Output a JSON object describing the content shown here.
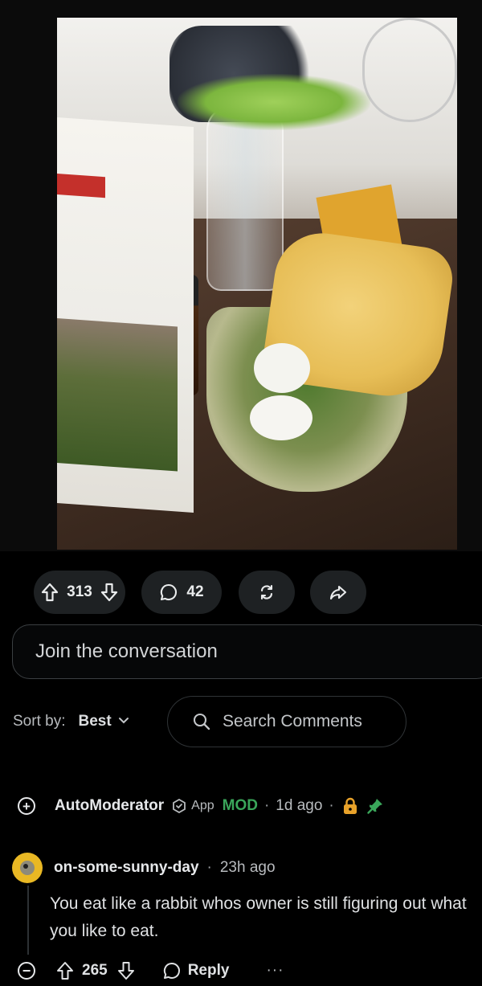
{
  "post": {
    "image_alt": "Glass bowl with eggs, greens and a tortilla chip next to a milk carton and a glass carafe with celery"
  },
  "actions": {
    "upvotes": "313",
    "comments": "42"
  },
  "composer": {
    "placeholder": "Join the conversation"
  },
  "sort": {
    "label": "Sort by:",
    "value": "Best",
    "search_placeholder": "Search Comments"
  },
  "comments": [
    {
      "author": "AutoModerator",
      "app_label": "App",
      "mod_label": "MOD",
      "time": "1d ago",
      "expand_symbol": "+"
    },
    {
      "author": "on-some-sunny-day",
      "time": "23h ago",
      "body": "You eat like a rabbit whos owner is still figuring out what you like to eat.",
      "score": "265",
      "reply_label": "Reply",
      "more_label": "···",
      "collapse_symbol": "−"
    }
  ],
  "colors": {
    "background": "#000000",
    "pill": "#1e2123",
    "mod_green": "#3aa65a",
    "lock_orange": "#e8a22a"
  }
}
